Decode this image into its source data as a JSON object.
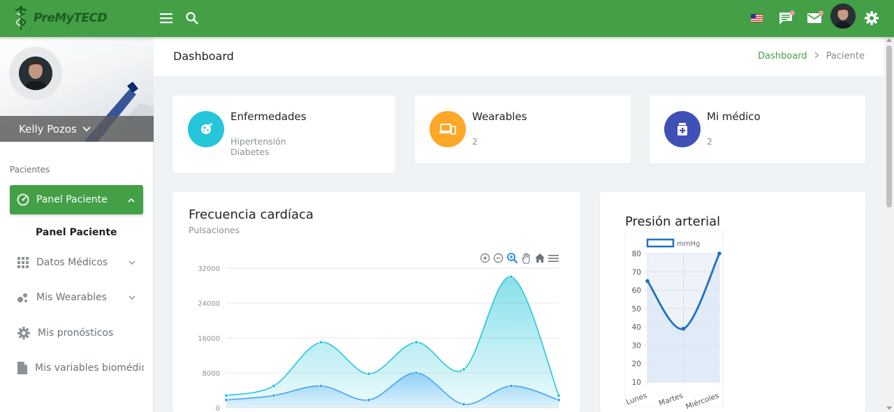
{
  "app": {
    "logo_text": "PreMyTECD"
  },
  "topbar": {
    "icons": [
      "menu-icon",
      "search-icon",
      "us-flag-icon",
      "chat-icon",
      "mail-icon",
      "settings-icon"
    ]
  },
  "sidebar": {
    "user_name": "Kelly Pozos",
    "section_label": "Pacientes",
    "active_item": "Panel Paciente",
    "active_sub_item": "Panel Paciente",
    "items": [
      {
        "label": "Datos Médicos",
        "icon": "grid-icon"
      },
      {
        "label": "Mis Wearables",
        "icon": "bubbles-icon"
      },
      {
        "label": "Mis pronósticos",
        "icon": "gear-icon"
      },
      {
        "label": "Mis variables biomédicas",
        "icon": "document-icon"
      }
    ]
  },
  "header": {
    "title": "Dashboard",
    "breadcrumb": [
      "Dashboard",
      "Paciente"
    ]
  },
  "cards": {
    "enfermedades": {
      "title": "Enfermedades",
      "values": [
        "Hipertensión",
        "Diabetes"
      ],
      "color": "#26c6da"
    },
    "wearables": {
      "title": "Wearables",
      "value": "2",
      "color": "#ffa726"
    },
    "medico": {
      "title": "Mi médico",
      "value": "2",
      "color": "#3f51b5"
    }
  },
  "chart_data": [
    {
      "type": "area",
      "title": "Frecuencia cardíaca",
      "subtitle": "Pulsaciones",
      "y_ticks": [
        "32000",
        "24000",
        "16000",
        "8000",
        "0"
      ],
      "ylim": [
        0,
        32000
      ],
      "grid": true,
      "series": [
        {
          "values": [
            2800,
            5000,
            15000,
            7800,
            15000,
            8800,
            30000,
            2800
          ],
          "color": "#26c6da"
        },
        {
          "values": [
            1800,
            2800,
            5000,
            1800,
            8000,
            800,
            5000,
            1800
          ],
          "color": "#42a5f5"
        }
      ]
    },
    {
      "type": "area",
      "title": "Presión arterial",
      "categories": [
        "Lunes",
        "Martes",
        "Miércoles"
      ],
      "y_ticks": [
        "80",
        "70",
        "60",
        "50",
        "40",
        "30",
        "20",
        "10"
      ],
      "ylim": [
        10,
        80
      ],
      "legend": "top",
      "grid": true,
      "series": [
        {
          "name": "mmHg",
          "values": [
            65,
            39,
            80
          ],
          "color": "#1e70c1"
        }
      ]
    }
  ]
}
